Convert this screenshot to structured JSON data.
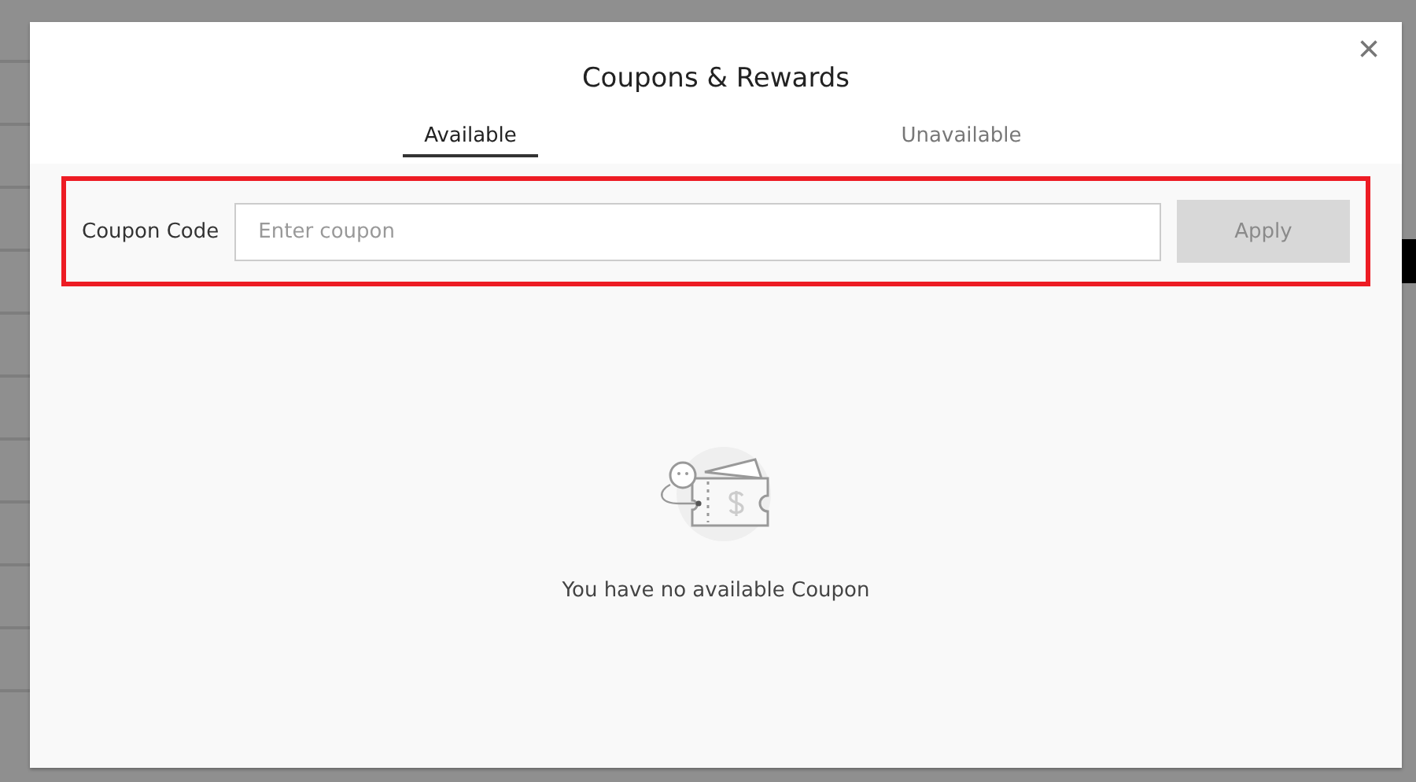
{
  "dialog": {
    "title": "Coupons & Rewards",
    "close": "×"
  },
  "tabs": [
    {
      "label": "Available",
      "selected": true
    },
    {
      "label": "Unavailable",
      "selected": false
    }
  ],
  "coupon_form": {
    "label": "Coupon Code",
    "placeholder": "Enter coupon",
    "button": "Apply",
    "button_disabled": true,
    "highlighted": true
  },
  "empty_state": {
    "message": "You have no available Coupon"
  }
}
